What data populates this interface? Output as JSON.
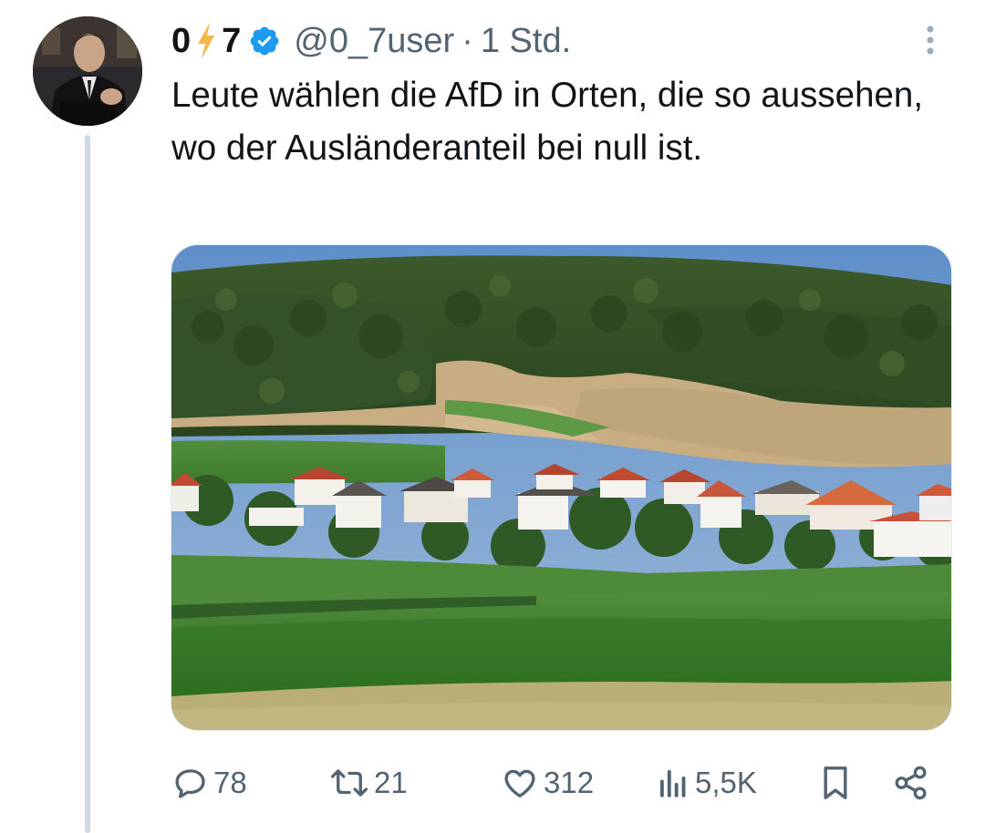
{
  "tweet": {
    "author": {
      "name_part1": "0",
      "name_part2": "7",
      "name_icon": "lightning-bolt-icon",
      "verified_icon": "verified-badge-icon",
      "handle": "@0_7user",
      "separator": "·",
      "time": "1 Std."
    },
    "text": "Leute wählen die AfD in Orten, die so aussehen, wo der Ausländeranteil bei null ist.",
    "actions": {
      "reply_count": "78",
      "retweet_count": "21",
      "like_count": "312",
      "view_count": "5,5K"
    }
  },
  "colors": {
    "text": "#0f1419",
    "secondary": "#536471",
    "verified": "#1d9bf0",
    "bolt": "#f2b84b",
    "thread_line": "#cfd9de"
  }
}
